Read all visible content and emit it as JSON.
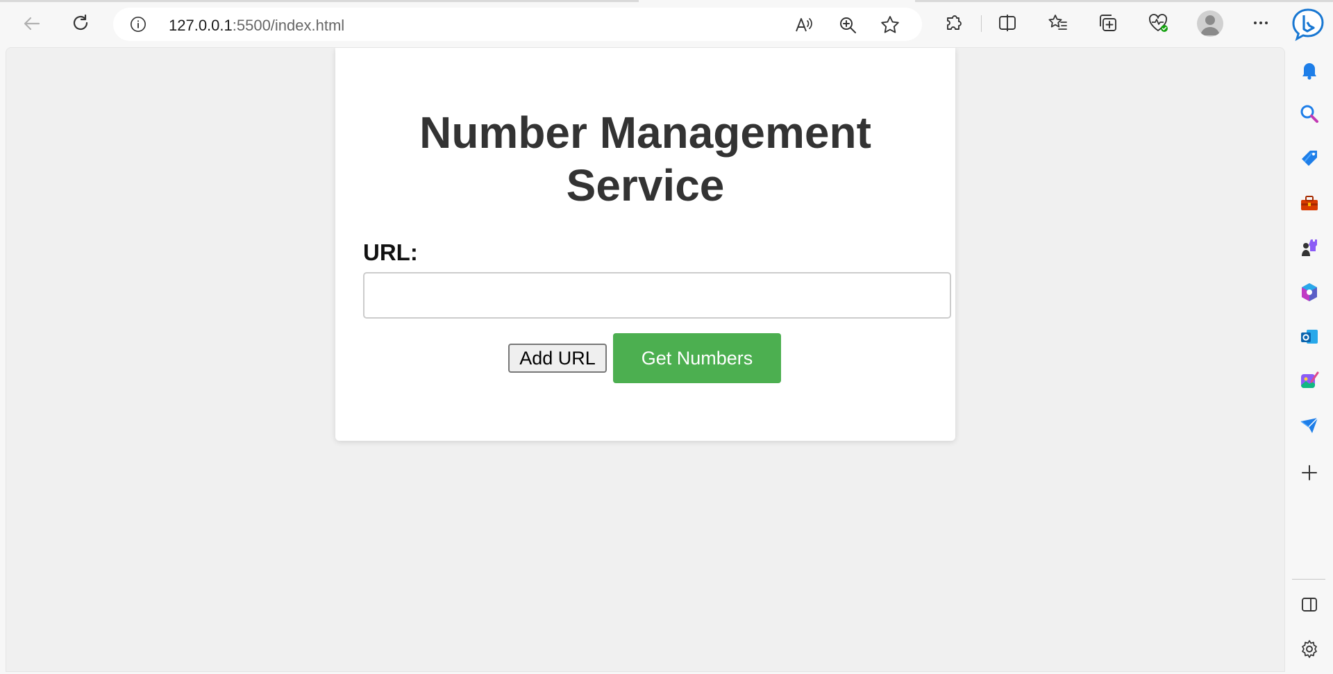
{
  "browser": {
    "url_host": "127.0.0.1",
    "url_rest": ":5500/index.html",
    "toolbar_icons": [
      "read-aloud-icon",
      "zoom-icon",
      "favorite-star-icon",
      "extensions-icon",
      "split-screen-icon",
      "favorites-icon",
      "collections-icon",
      "browser-essentials-icon",
      "profile-avatar",
      "more-icon",
      "bing-copilot-icon"
    ],
    "sidebar_icons": [
      "bell-icon",
      "search-icon",
      "shopping-tag-icon",
      "tools-icon",
      "games-icon",
      "microsoft-365-icon",
      "outlook-icon",
      "designer-icon",
      "send-icon",
      "add-icon",
      "sidebar-toggle-icon",
      "settings-icon"
    ]
  },
  "page": {
    "title": "Number Management Service",
    "url_label": "URL:",
    "url_input_value": "",
    "add_url_label": "Add URL",
    "get_numbers_label": "Get Numbers"
  },
  "colors": {
    "accent_green": "#4caf50",
    "heading": "#333333",
    "page_bg": "#f0f0f0"
  }
}
